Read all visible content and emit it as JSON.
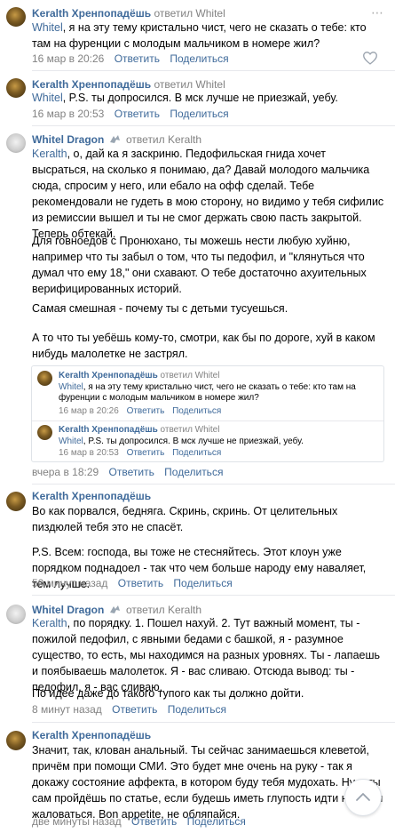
{
  "actions": {
    "reply": "Ответить",
    "share": "Поделиться"
  },
  "comments": [
    {
      "author": "Keralth Хренпопадёшь",
      "reply_to": "ответил Whitel",
      "mention": "Whitel",
      "text_rest": ", я на эту тему кристально чист, чего не сказать о тебе: кто там на фуренции с молодым мальчиком в номере жил?",
      "time": "16 мар в 20:26"
    },
    {
      "author": "Keralth Хренпопадёшь",
      "reply_to": "ответил Whitel",
      "mention": "Whitel",
      "text_rest": ", P.S. ты допросился. В мск лучше не приезжай, уебу.",
      "time": "16 мар в 20:53"
    },
    {
      "author": "Whitel Dragon",
      "reply_to": "ответил Keralth",
      "mention": "Keralth",
      "p1_rest": ", о, дай ка я заскриню. Педофильская гнида хочет высраться, на сколько я понимаю, да? Давай молодого мальчика сюда, спросим у него, или ебало на офф сделай. Тебе рекомендовали не гудеть в мою сторону, но видимо у тебя сифилис из ремиссии вышел и ты не смог держать свою пасть закрытой. Теперь обтекай.",
      "p2": "Для говноедов с Пронюхано, ты можешь нести любую хуйню, например что ты забыл о том, что ты педофил, и \"клянуться что думал что ему 18,\" они схавают. О тебе достаточно ахуительных верифицированных историй.",
      "p3": "Самая смешная - почему ты с детьми тусуешься.",
      "p4": "А то что ты уебёшь кому-то, смотри, как бы по дороге, хуй в каком нибудь малолетке не застрял.",
      "quotes": [
        {
          "author": "Keralth Хренпопадёшь",
          "reply_to": "ответил Whitel",
          "mention": "Whitel",
          "text_rest": ", я на эту тему кристально чист, чего не сказать о тебе: кто там на фуренции с молодым мальчиком в номере жил?",
          "time": "16 мар в 20:26"
        },
        {
          "author": "Keralth Хренпопадёшь",
          "reply_to": "ответил Whitel",
          "mention": "Whitel",
          "text_rest": ", P.S. ты допросился. В мск лучше не приезжай, уебу.",
          "time": "16 мар в 20:53"
        }
      ],
      "time": "вчера в 18:29"
    },
    {
      "author": "Keralth Хренпопадёшь",
      "p1": "Во как порвался, бедняга. Скринь, скринь. От целительных пиздюлей тебя это не спасёт.",
      "p2": "P.S. Всем: господа, вы тоже не стесняйтесь. Этот клоун уже порядком поднадоел - так что чем больше народу ему наваляет, тем лучше.",
      "time": "50 минут назад"
    },
    {
      "author": "Whitel Dragon",
      "reply_to": "ответил Keralth",
      "mention": "Keralth",
      "p1_rest": ", по порядку. 1. Пошел нахуй. 2. Тут важный момент, ты - пожилой педофил, с явными бедами с башкой, я - разумное существо, то есть, мы находимся на разных уровнях. Ты - лапаешь и поябываешь малолеток. Я - вас сливаю. Отсюда вывод: ты - педофил, я - вас сливаю.",
      "p2": "По идее даже до такого тупого как ты должно дойти.",
      "time": "8 минут назад"
    },
    {
      "author": "Keralth Хренпопадёшь",
      "p1": "Значит, так, клован анальный. Ты сейчас занимаешься клеветой, причём при помощи СМИ. Это будет мне очень на руку - так я докажу состояние аффекта, в котором буду тебя мудохать. Ну и ты сам пройдёшь по статье, если будешь иметь глупость идти на меня жаловаться. Bon appetite, не обляпайся.",
      "time": "две минуты назад"
    }
  ]
}
